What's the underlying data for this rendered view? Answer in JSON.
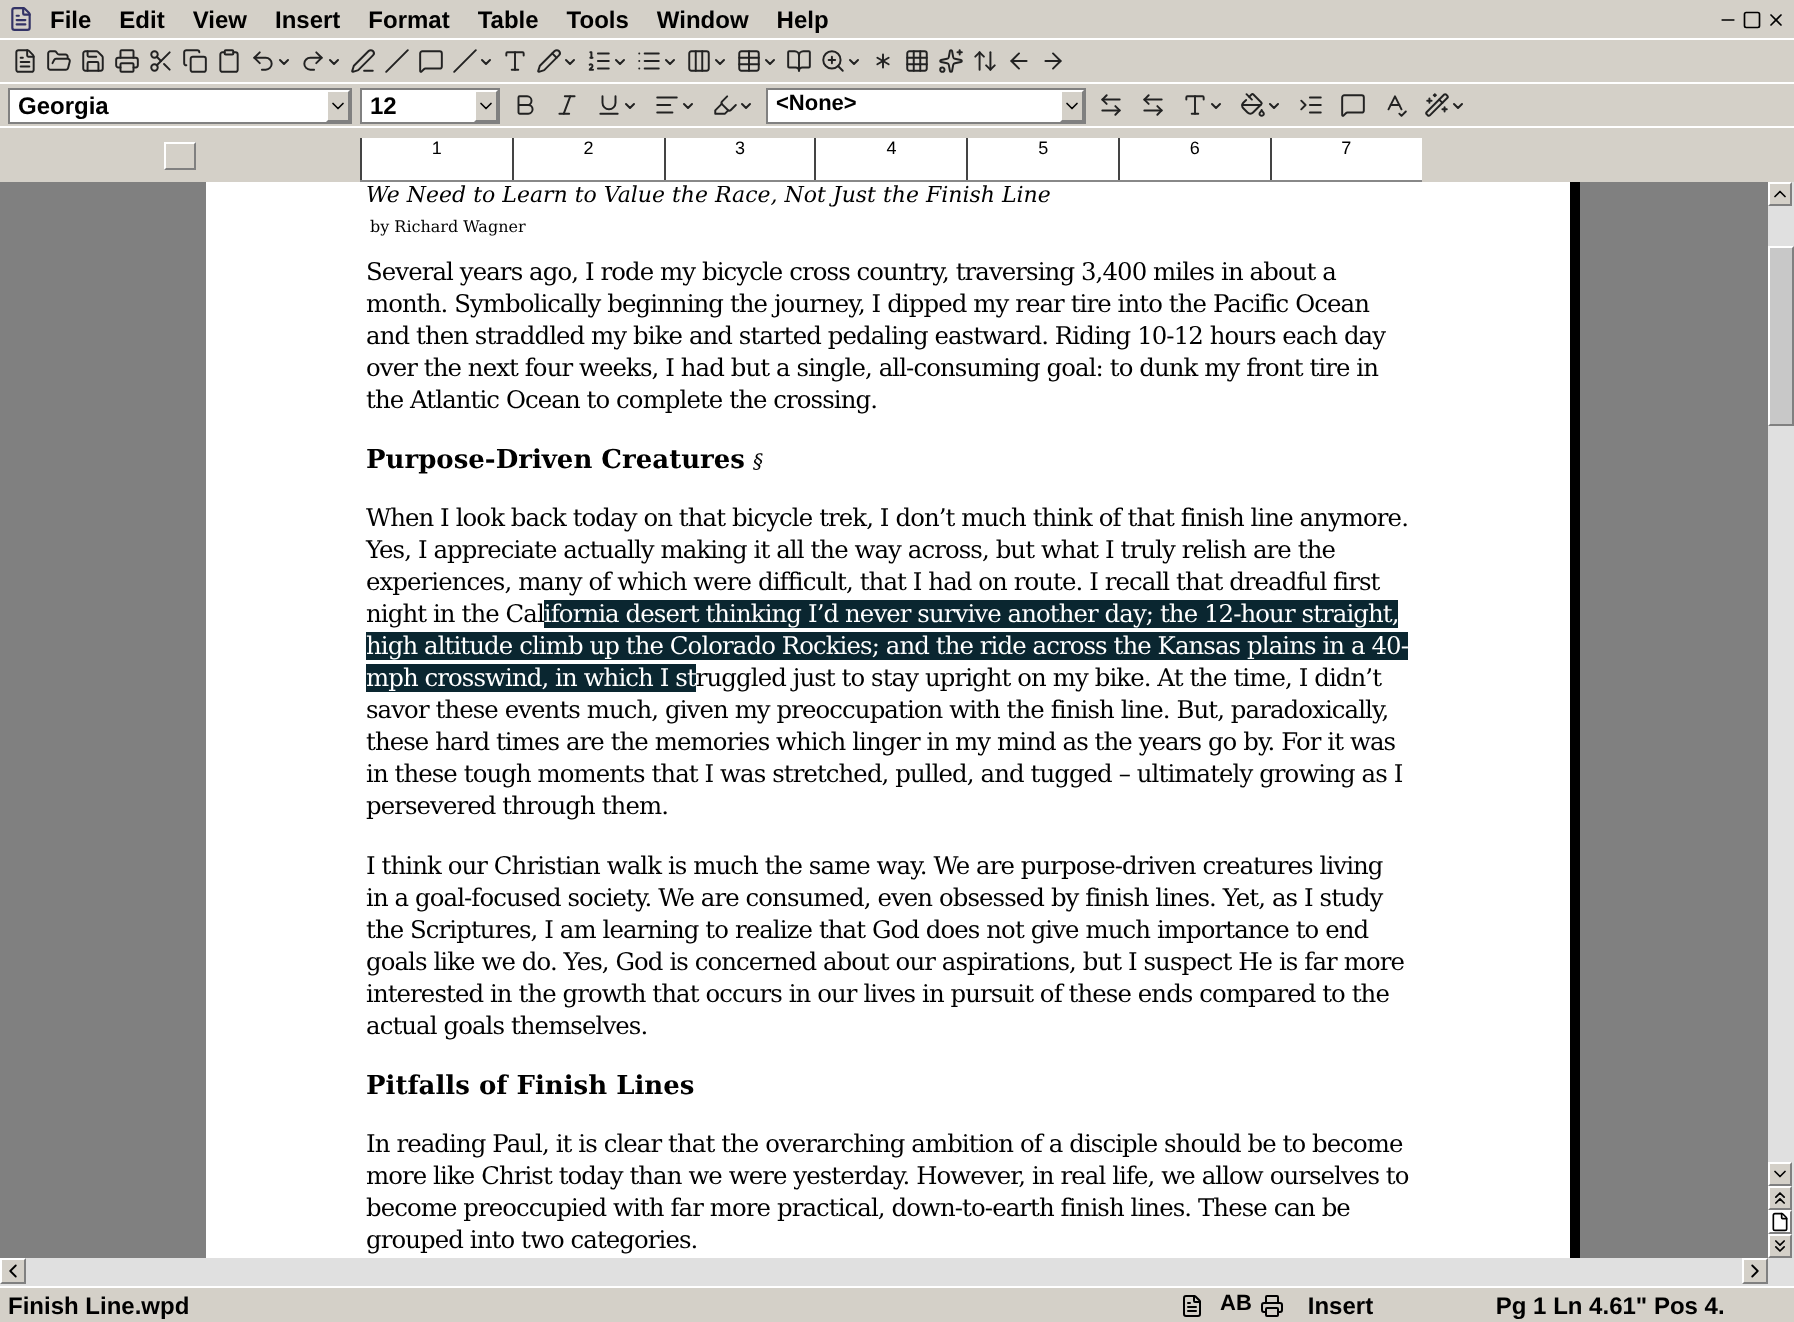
{
  "menu_bar": {
    "items": [
      {
        "label": "File"
      },
      {
        "label": "Edit"
      },
      {
        "label": "View"
      },
      {
        "label": "Insert"
      },
      {
        "label": "Format"
      },
      {
        "label": "Table"
      },
      {
        "label": "Tools"
      },
      {
        "label": "Window"
      },
      {
        "label": "Help"
      }
    ]
  },
  "format_bar": {
    "font": "Georgia",
    "size": "12",
    "style": "<None>"
  },
  "ruler": {
    "labels": [
      "1",
      "2",
      "3",
      "4",
      "5",
      "6",
      "7"
    ]
  },
  "document": {
    "title": "We Need to Learn to Value the Race, Not Just the Finish Line",
    "byline": "by Richard Wagner",
    "blocks": [
      {
        "kind": "paragraph",
        "text": "Several years ago, I rode my bicycle cross country, traversing 3,400 miles in about a month. Symbolically beginning the journey, I dipped my rear tire into the Pacific Ocean and then straddled my bike and started pedaling eastward. Riding 10-12 hours each day over the next four weeks, I had but a single, all-consuming goal: to dunk my front tire in the Atlantic Ocean to complete the crossing."
      },
      {
        "kind": "heading",
        "text": "Purpose-Driven Creatures",
        "mark": "§"
      },
      {
        "kind": "paragraph",
        "text": "When I look back today on that bicycle trek, I don’t much think of that finish line anymore. Yes, I appreciate actually making it all the way across, but what I truly relish are the experiences, many of which were difficult, that I had on route. I recall that dreadful first night in the Cal",
        "selected_text": "ifornia desert thinking I’d never survive another day; the 12-hour straight, high altitude climb up the Colorado Rockies; and the ride across the Kansas plains in a 40-mph crosswind, in which I st",
        "text_after": "ruggled just to stay upright on my bike. At the time, I didn’t savor these events much, given my preoccupation with the finish line. But, paradoxically, these hard times are the memories which linger in my mind as the years go by. For it was in these tough moments that I was stretched, pulled, and tugged – ultimately growing as I persevered through them."
      },
      {
        "kind": "paragraph",
        "text": "I think our Christian walk is much the same way. We are purpose-driven creatures living in a goal-focused society. We are consumed, even obsessed by finish lines. Yet, as I study the Scriptures, I am learning to realize that God does not give much importance to end goals like we do. Yes, God is concerned about our aspirations, but I suspect He is far more interested in the growth that occurs in our lives in pursuit of these ends compared to the actual goals themselves."
      },
      {
        "kind": "heading",
        "text": "Pitfalls of Finish Lines"
      },
      {
        "kind": "paragraph",
        "text": "In reading Paul, it is clear that the overarching ambition of a disciple should be to become more like Christ today than we were yesterday. However, in real life, we allow ourselves to become preoccupied with far more practical, down-to-earth finish lines. These can be grouped into two categories."
      }
    ]
  },
  "status_bar": {
    "file": "Finish Line.wpd",
    "icon_text": "AB",
    "mode": "Insert",
    "position": "Pg 1 Ln 4.61\" Pos 4."
  }
}
